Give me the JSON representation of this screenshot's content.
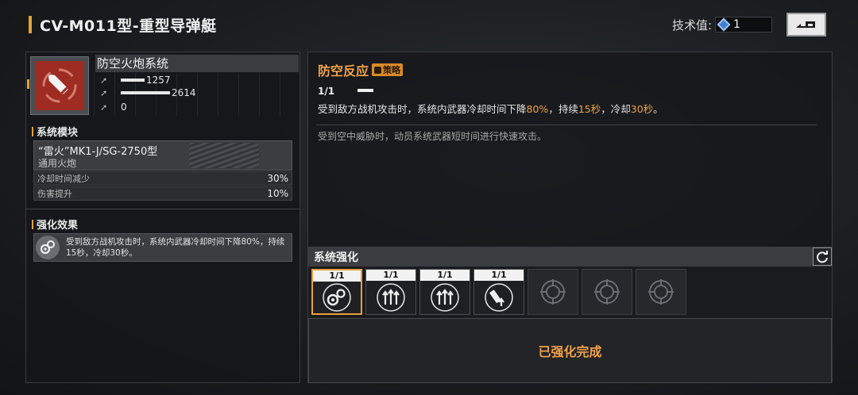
{
  "header": {
    "title": "CV-M011型-重型导弹艇",
    "tech_label": "技术值:",
    "tech_value": "1",
    "back_icon": "back-arrow-icon"
  },
  "weapon": {
    "name": "防空火炮系统",
    "icon": "bullet-crosshair-icon",
    "stats": [
      {
        "icon": "arrow-up-icon",
        "value": "1257",
        "bar_fraction": 0.26
      },
      {
        "icon": "arrow-up-icon",
        "value": "2614",
        "bar_fraction": 0.55
      },
      {
        "icon": "arrow-up-icon",
        "value": "0",
        "bar_fraction": 0
      }
    ]
  },
  "modules": {
    "section_title": "系统模块",
    "card_name": "“雷火”MK1-J/SG-2750型",
    "card_sub": "通用火炮",
    "rows": [
      {
        "label": "冷却时间减少",
        "value": "30%"
      },
      {
        "label": "伤害提升",
        "value": "10%"
      }
    ]
  },
  "enhancement_effect": {
    "section_title": "强化效果",
    "icon": "gear-chain-icon",
    "text": "受到敌方战机攻击时，系统内武器冷却时间下降80%，持续15秒，冷却30秒。"
  },
  "skill": {
    "title": "防空反应",
    "tag": "策略",
    "level": "1/1",
    "desc_parts": [
      "受到敌方战机攻击时，系统内武器冷却时间下降",
      "80%",
      "，持续",
      "15秒",
      "，冷却",
      "30秒",
      "。"
    ],
    "flavor": "受到空中威胁时，动员系统武器短时间进行快速攻击。"
  },
  "system_enhance": {
    "title": "系统强化",
    "refresh_icon": "refresh-icon",
    "slots": [
      {
        "count": "1/1",
        "icon": "gear-chain-icon",
        "active": true
      },
      {
        "count": "1/1",
        "icon": "triple-arrow-up-icon",
        "active": false
      },
      {
        "count": "1/1",
        "icon": "triple-arrow-up-icon",
        "active": false
      },
      {
        "count": "1/1",
        "icon": "cannon-up-icon",
        "active": false
      },
      {
        "count": "",
        "icon": "locked-target-icon",
        "active": false
      },
      {
        "count": "",
        "icon": "locked-target-icon",
        "active": false
      },
      {
        "count": "",
        "icon": "locked-target-icon",
        "active": false
      }
    ],
    "complete_text": "已强化完成"
  },
  "colors": {
    "accent": "#f0a14a",
    "weapon_icon_bg": "#9e2c23"
  }
}
